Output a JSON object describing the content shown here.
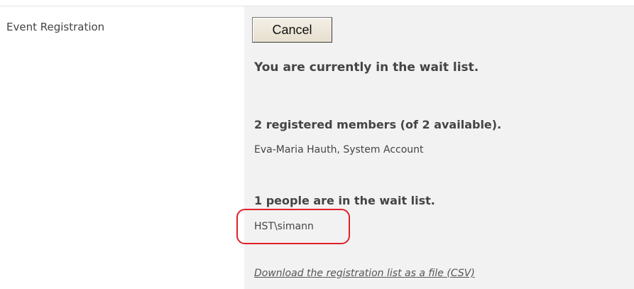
{
  "form": {
    "field_label": "Event Registration"
  },
  "registration": {
    "cancel_label": "Cancel",
    "status_message": "You are currently in the wait list.",
    "registered_heading": "2 registered members (of 2 available).",
    "registered_names": "Eva-Maria Hauth, System Account",
    "waitlist_heading": "1 people are in the wait list.",
    "waitlist_names": "HST\\simann",
    "download_link": "Download the registration list as a file (CSV)"
  },
  "colors": {
    "panel_background": "#f2f2f2",
    "highlight": "#e0202a",
    "text": "#444444"
  }
}
